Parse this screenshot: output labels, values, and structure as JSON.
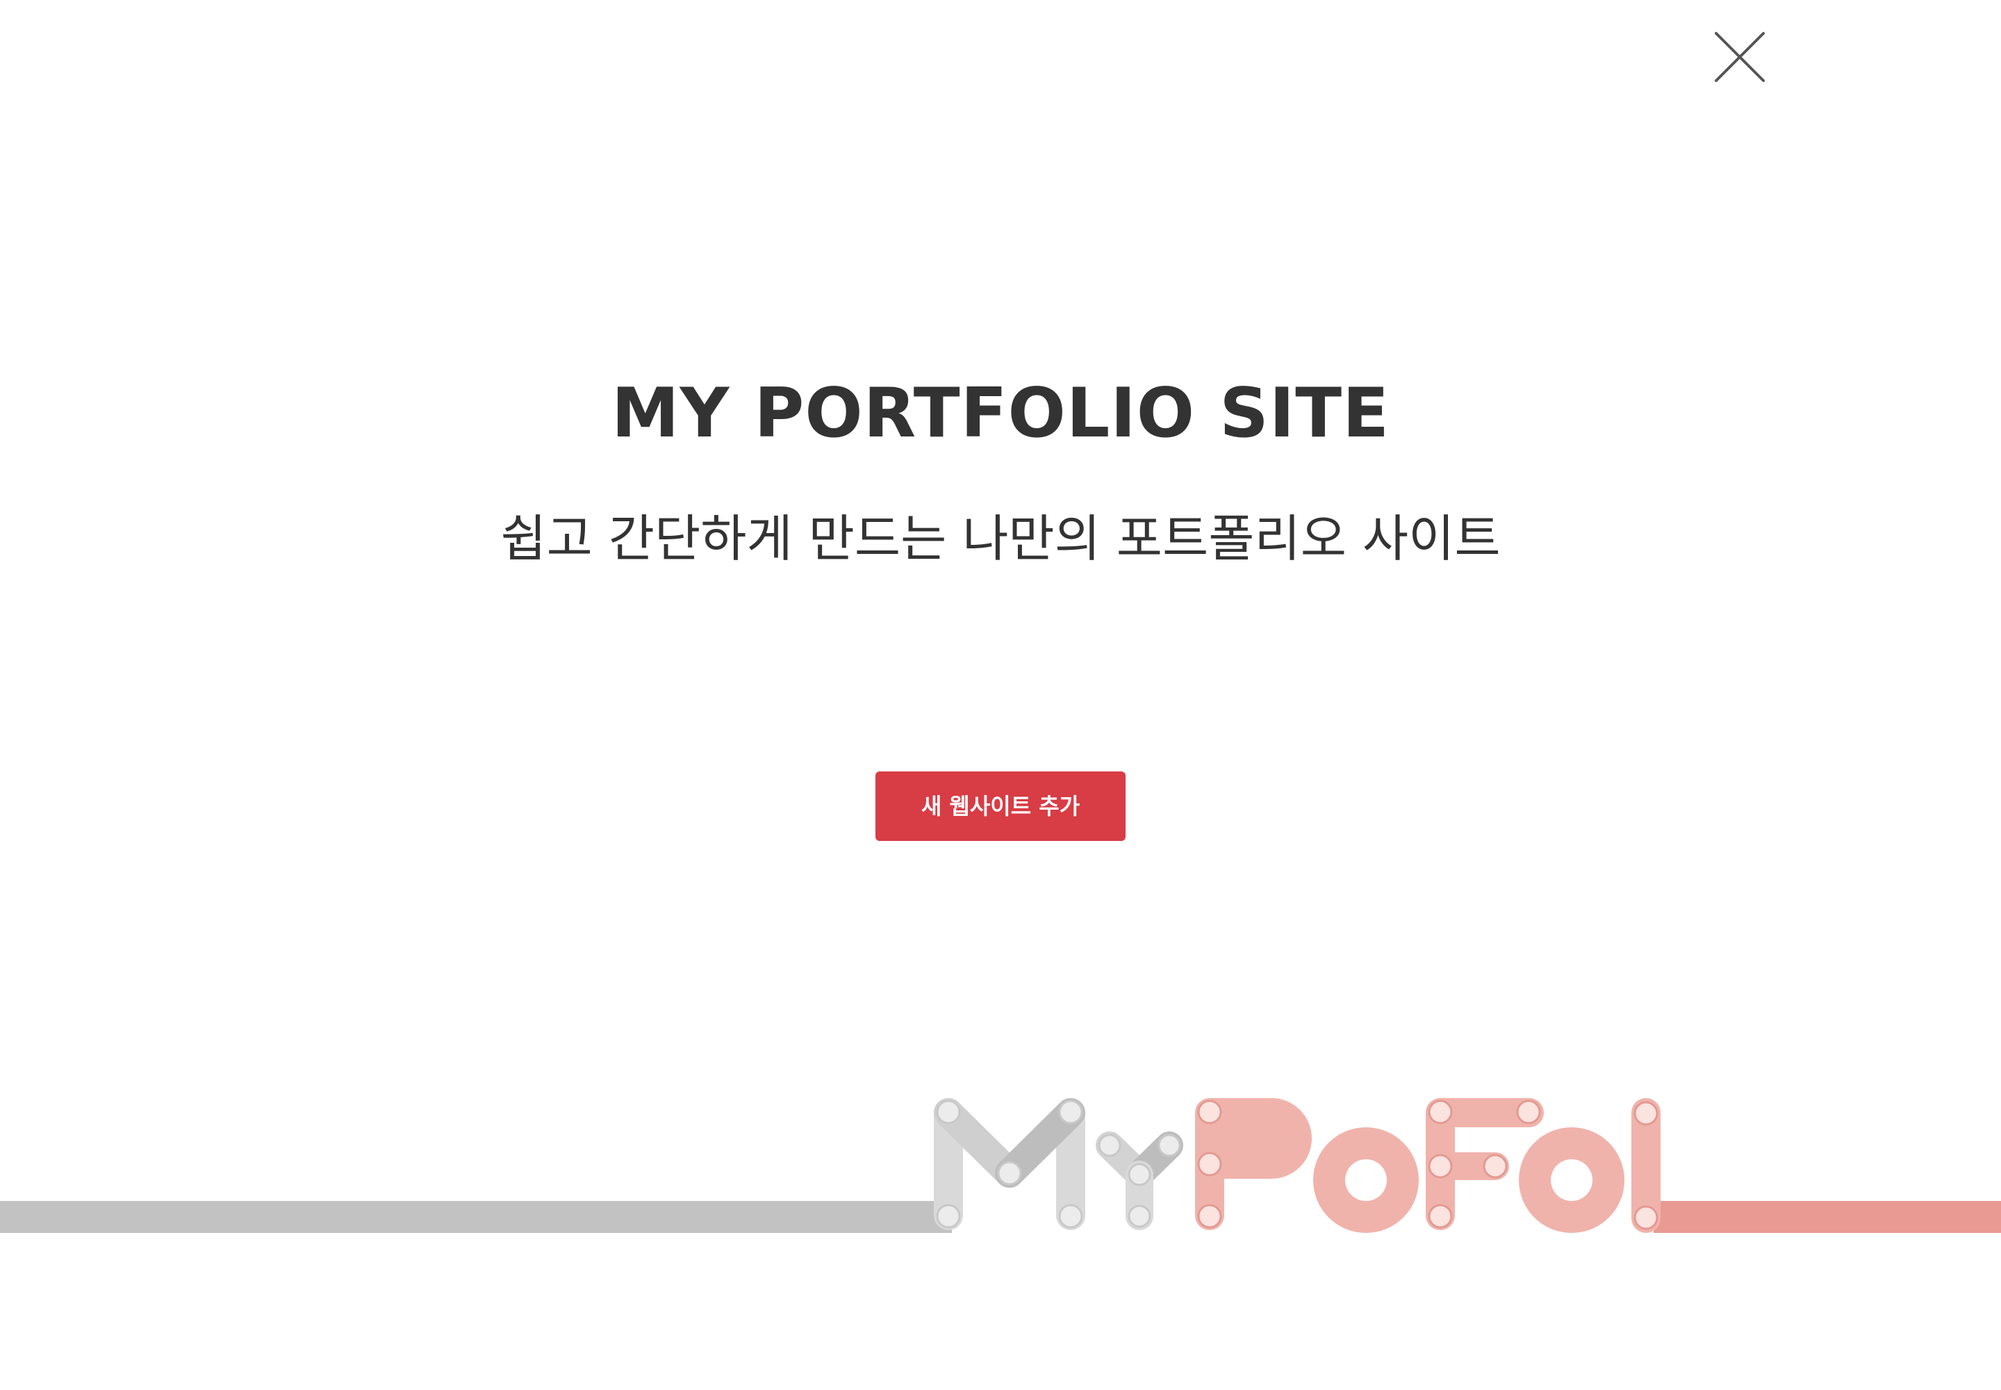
{
  "close": {
    "icon": "close-icon"
  },
  "hero": {
    "title": "MY PORTFOLIO SITE",
    "subtitle": "쉽고 간단하게 만드는 나만의 포트폴리오 사이트",
    "add_button_label": "새 웹사이트 추가"
  },
  "logo": {
    "text_grey": "My",
    "text_pink": "PoFol",
    "color_grey": "#d9d9d9",
    "color_grey_dark": "#a9a9a9",
    "color_pink": "#f0b3ab",
    "color_pink_dark": "#e29a92",
    "line_grey": "#c2c2c2",
    "line_pink": "#e99a93"
  },
  "colors": {
    "accent": "#d83c45",
    "text": "#333333",
    "background": "#ffffff"
  }
}
